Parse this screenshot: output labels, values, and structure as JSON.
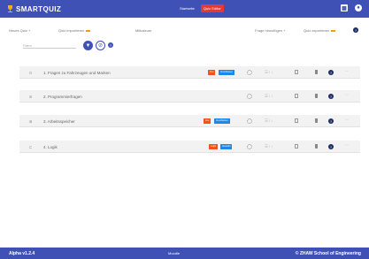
{
  "header": {
    "brand": "SMARTQUIZ",
    "nav": [
      "Startseite",
      "Quiz Editor"
    ],
    "icons": [
      "grid-icon",
      "account-icon"
    ]
  },
  "toolbar": {
    "new_quiz": "Neues Quiz +",
    "quiz_import": "Quiz importieren",
    "quiz_name": "Mitkatzuer",
    "add_question": "Frage hinzufügen +",
    "quiz_export": "Quiz exportieren"
  },
  "filter": {
    "placeholder": "Filtern"
  },
  "rows": [
    {
      "num": "1.",
      "label": "Fragen zu Fahrzeugen und Marken",
      "badges": [
        {
          "text": "Frei",
          "color": "#f4511e"
        },
        {
          "text": "Verschieben",
          "color": "#1e88e5"
        }
      ]
    },
    {
      "num": "2.",
      "label": "Programmierfragen",
      "badges": []
    },
    {
      "num": "3.",
      "label": "Arbeitsspeicher",
      "badges": [
        {
          "text": "Frei",
          "color": "#f4511e"
        },
        {
          "text": "Verschieben",
          "color": "#1e88e5"
        }
      ]
    },
    {
      "num": "4.",
      "label": "Logik",
      "badges": [
        {
          "text": "Logik",
          "color": "#f4511e"
        },
        {
          "text": "Auswahl",
          "color": "#1e88e5"
        }
      ]
    }
  ],
  "footer": {
    "version": "Alpha v1.2.4",
    "middle": "Moodle",
    "right": "© ZHAW School of Engineering"
  },
  "colors": {
    "primary": "#3f51b5",
    "accent": "#e53935",
    "badge_red": "#f4511e",
    "badge_blue": "#1e88e5",
    "help": "#1d2d66"
  }
}
